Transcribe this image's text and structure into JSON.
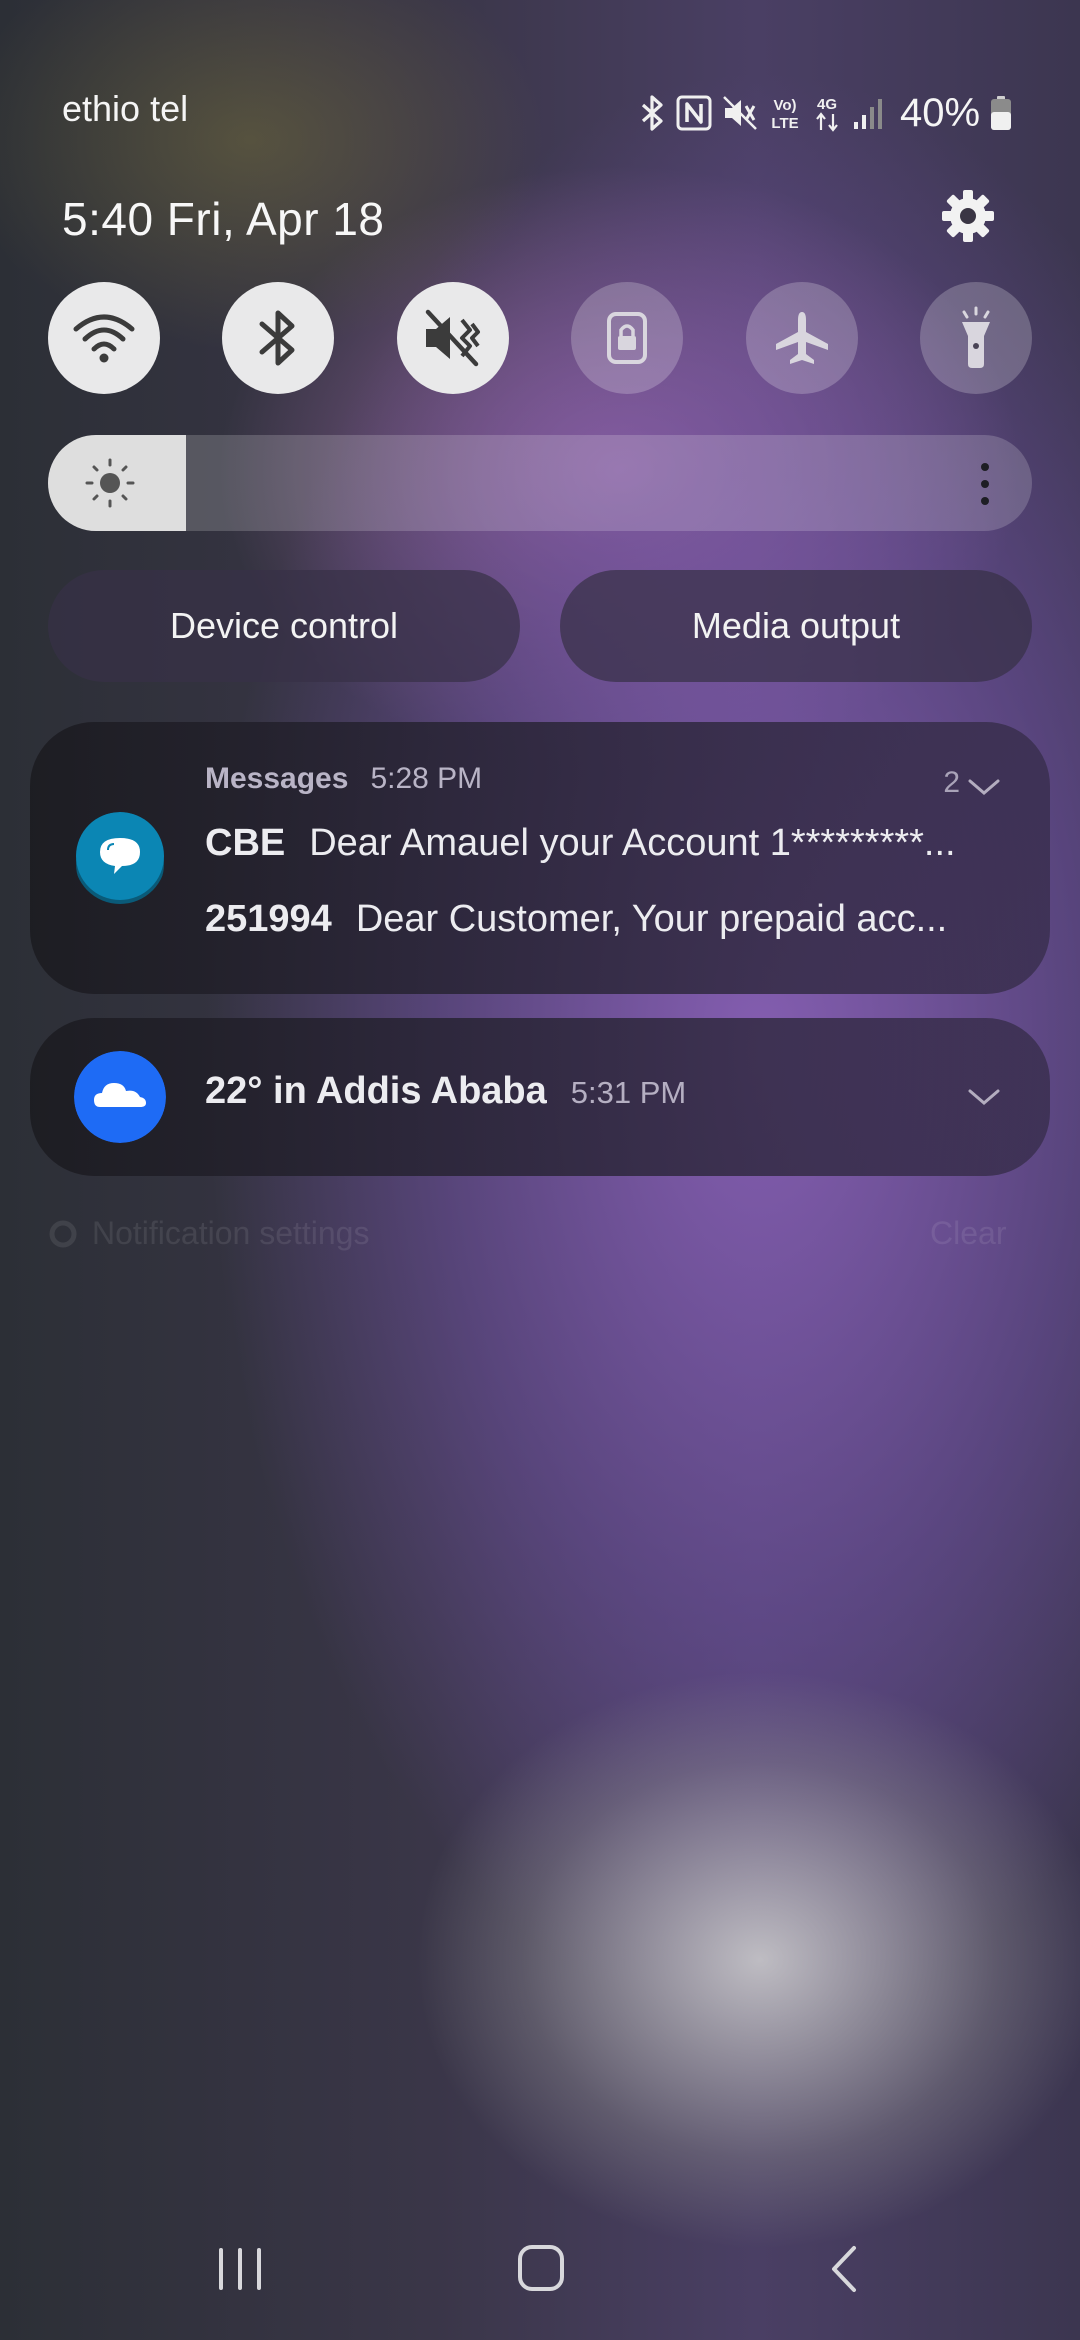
{
  "status_bar": {
    "carrier": "ethio tel",
    "battery_percent": "40%",
    "icons": [
      "bluetooth-icon",
      "nfc-icon",
      "mute-icon",
      "volte-icon",
      "4g-data-icon",
      "signal-icon",
      "battery-icon"
    ],
    "network_label_top": "4G",
    "volte_top": "Vo)",
    "volte_bottom": "LTE"
  },
  "header": {
    "time_date": "5:40  Fri, Apr 18"
  },
  "quick_settings": [
    {
      "name": "wifi",
      "icon": "wifi-icon",
      "state": "on"
    },
    {
      "name": "bluetooth",
      "icon": "bluetooth-icon",
      "state": "on"
    },
    {
      "name": "sound",
      "icon": "mute-icon",
      "state": "on"
    },
    {
      "name": "rotation-lock",
      "icon": "lock-icon",
      "state": "off"
    },
    {
      "name": "airplane-mode",
      "icon": "airplane-icon",
      "state": "off"
    },
    {
      "name": "flashlight",
      "icon": "flashlight-icon",
      "state": "off"
    }
  ],
  "brightness": {
    "level": 0.14
  },
  "buttons": {
    "device_control": "Device control",
    "media_output": "Media output"
  },
  "notifications": {
    "messages": {
      "app": "Messages",
      "time": "5:28 PM",
      "count": "2",
      "items": [
        {
          "sender": "CBE",
          "text": "Dear Amauel your Account 1*********..."
        },
        {
          "sender": "251994",
          "text": "Dear Customer,   Your prepaid acc..."
        }
      ]
    },
    "weather": {
      "title": "22° in Addis Ababa",
      "time": "5:31 PM"
    }
  },
  "footer": {
    "notification_settings": "Notification settings",
    "clear": "Clear"
  },
  "colors": {
    "messages_icon": "#0b86b4",
    "weather_icon": "#1e6bf5",
    "tile_on": "#e9e9ea"
  }
}
